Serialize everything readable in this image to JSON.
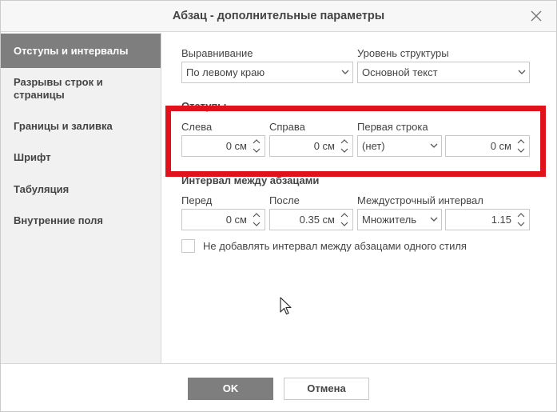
{
  "dialog": {
    "title": "Абзац - дополнительные параметры"
  },
  "sidebar": {
    "items": [
      {
        "label": "Отступы и интервалы",
        "active": true
      },
      {
        "label": "Разрывы строк и страницы",
        "active": false
      },
      {
        "label": "Границы и заливка",
        "active": false
      },
      {
        "label": "Шрифт",
        "active": false
      },
      {
        "label": "Табуляция",
        "active": false
      },
      {
        "label": "Внутренние поля",
        "active": false
      }
    ]
  },
  "alignment": {
    "label": "Выравнивание",
    "value": "По левому краю"
  },
  "outline": {
    "label": "Уровень структуры",
    "value": "Основной текст"
  },
  "indents": {
    "section_label": "Отступы",
    "left": {
      "label": "Слева",
      "value": "0 см"
    },
    "right": {
      "label": "Справа",
      "value": "0 см"
    },
    "first_line": {
      "label": "Первая строка",
      "select_value": "(нет)",
      "value": "0 см"
    }
  },
  "spacing": {
    "section_label": "Интервал между абзацами",
    "before": {
      "label": "Перед",
      "value": "0 см"
    },
    "after": {
      "label": "После",
      "value": "0.35 см"
    },
    "line": {
      "label": "Междустрочный интервал",
      "select_value": "Множитель",
      "value": "1.15"
    }
  },
  "no_spacing_checkbox": {
    "label": "Не добавлять интервал между абзацами одного стиля",
    "checked": false
  },
  "buttons": {
    "ok": "OK",
    "cancel": "Отмена"
  },
  "colors": {
    "highlight": "#e0121b",
    "active_tab": "#7e7e7e",
    "sidebar_bg": "#f1f1f1"
  },
  "icons": {
    "close": "close-icon",
    "dropdown": "chevron-down-icon",
    "spin_up": "chevron-up-icon",
    "spin_down": "chevron-down-icon",
    "cursor": "mouse-pointer-icon"
  }
}
